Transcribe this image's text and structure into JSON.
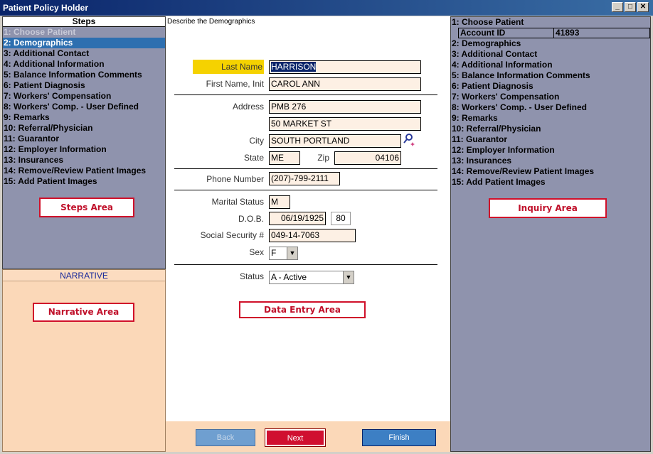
{
  "window": {
    "title": "Patient Policy Holder",
    "min": "_",
    "max": "□",
    "close": "✕"
  },
  "steps": {
    "header": "Steps",
    "items": [
      "1: Choose Patient",
      "2: Demographics",
      "3: Additional Contact",
      "4: Additional Information",
      "5: Balance Information Comments",
      "6: Patient Diagnosis",
      "7: Workers' Compensation",
      "8: Workers' Comp. - User Defined",
      "9: Remarks",
      "10: Referral/Physician",
      "11: Guarantor",
      "12: Employer Information",
      "13: Insurances",
      "14: Remove/Review Patient Images",
      "15: Add Patient Images"
    ],
    "area_label": "Steps Area"
  },
  "narrative": {
    "header": "NARRATIVE",
    "area_label": "Narrative Area"
  },
  "data_entry": {
    "description": "Describe the Demographics",
    "labels": {
      "last_name": "Last Name",
      "first_name": "First Name, Init",
      "address": "Address",
      "city": "City",
      "state": "State",
      "zip": "Zip",
      "phone": "Phone Number",
      "marital": "Marital Status",
      "dob": "D.O.B.",
      "ssn": "Social Security #",
      "sex": "Sex",
      "status": "Status"
    },
    "values": {
      "last_name": "HARRISON",
      "first_name": "CAROL ANN",
      "address1": "PMB 276",
      "address2": "50 MARKET ST",
      "city": "SOUTH PORTLAND",
      "state": "ME",
      "zip": "04106",
      "phone": "(207)-799-2111",
      "marital": "M",
      "dob": "06/19/1925",
      "age": "80",
      "ssn": "049-14-7063",
      "sex": "F",
      "status": "A - Active"
    },
    "area_label": "Data Entry Area"
  },
  "buttons": {
    "back": "Back",
    "next": "Next",
    "finish": "Finish"
  },
  "inquiry": {
    "items": [
      "2: Demographics",
      "3: Additional Contact",
      "4: Additional Information",
      "5: Balance Information Comments",
      "6: Patient Diagnosis",
      "7: Workers' Compensation",
      "8: Workers' Comp. - User Defined",
      "9: Remarks",
      "10: Referral/Physician",
      "11: Guarantor",
      "12: Employer Information",
      "13: Insurances",
      "14: Remove/Review Patient Images",
      "15: Add Patient Images"
    ],
    "choose_patient": "1: Choose Patient",
    "account_label": "Account ID",
    "account_value": "41893",
    "area_label": "Inquiry Area"
  },
  "colors": {
    "panel": "#8f93ad",
    "active_step": "#2d6fb0",
    "narrative_bg": "#fbd8b8",
    "highlight": "#f5d200",
    "annotation": "#d0102a"
  }
}
